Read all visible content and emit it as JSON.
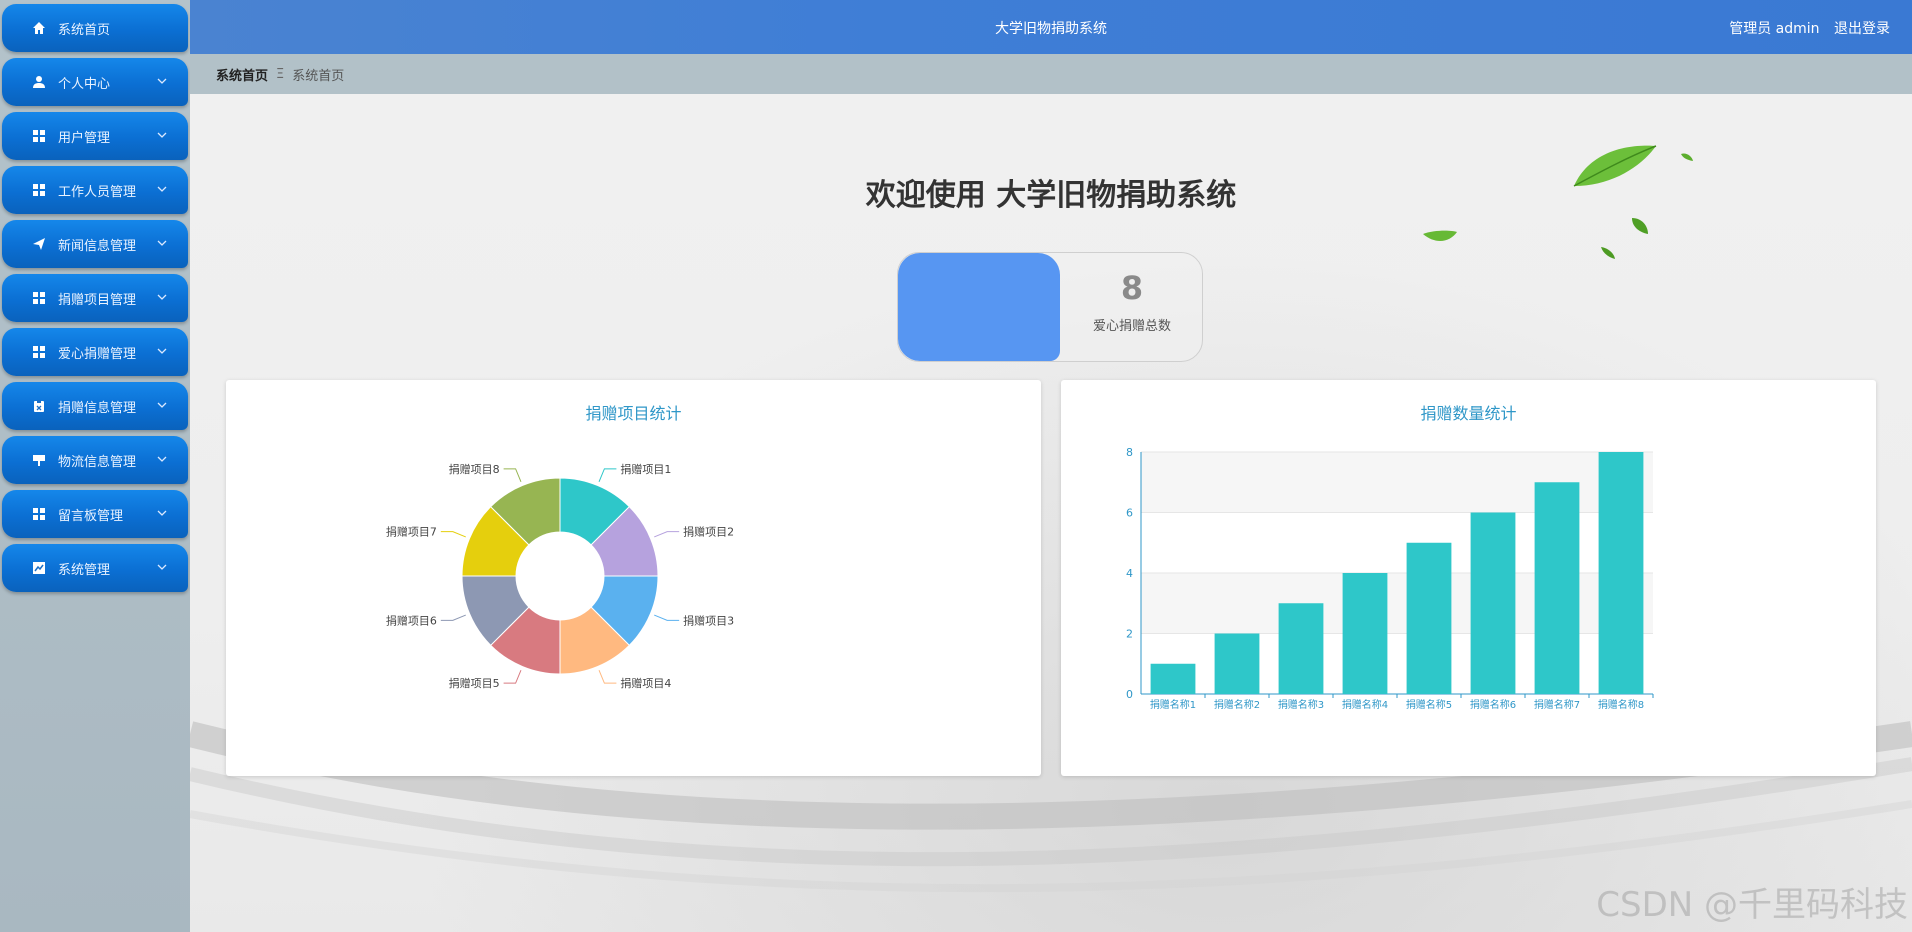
{
  "sidebar": {
    "items": [
      {
        "label": "系统首页",
        "icon": "home-icon",
        "chevron": false
      },
      {
        "label": "个人中心",
        "icon": "user-icon",
        "chevron": true
      },
      {
        "label": "用户管理",
        "icon": "grid-icon",
        "chevron": true
      },
      {
        "label": "工作人员管理",
        "icon": "grid-icon",
        "chevron": true
      },
      {
        "label": "新闻信息管理",
        "icon": "send-icon",
        "chevron": true
      },
      {
        "label": "捐赠项目管理",
        "icon": "grid-icon",
        "chevron": true
      },
      {
        "label": "爱心捐赠管理",
        "icon": "grid-icon",
        "chevron": true
      },
      {
        "label": "捐赠信息管理",
        "icon": "clipboard-icon",
        "chevron": true
      },
      {
        "label": "物流信息管理",
        "icon": "stand-icon",
        "chevron": true
      },
      {
        "label": "留言板管理",
        "icon": "grid-icon",
        "chevron": true
      },
      {
        "label": "系统管理",
        "icon": "chart-icon",
        "chevron": true
      }
    ]
  },
  "header": {
    "title": "大学旧物捐助系统",
    "user_label": "管理员 admin",
    "logout_label": "退出登录"
  },
  "breadcrumb": {
    "home": "系统首页",
    "sep": "Ξ",
    "current": "系统首页"
  },
  "main": {
    "welcome": "欢迎使用 大学旧物捐助系统",
    "stat": {
      "value": "8",
      "label": "爱心捐赠总数"
    }
  },
  "colors": {
    "accent": "#2f97c8",
    "bar": "#2ec7c9",
    "pie": [
      "#2ec7c9",
      "#b6a2de",
      "#5ab1ef",
      "#ffb980",
      "#d87a80",
      "#8d98b3",
      "#e5cf0d",
      "#97b552"
    ]
  },
  "chart_data": [
    {
      "type": "pie",
      "title": "捐赠项目统计",
      "categories": [
        "捐赠项目1",
        "捐赠项目2",
        "捐赠项目3",
        "捐赠项目4",
        "捐赠项目5",
        "捐赠项目6",
        "捐赠项目7",
        "捐赠项目8"
      ],
      "values": [
        1,
        1,
        1,
        1,
        1,
        1,
        1,
        1
      ],
      "donut": true,
      "legend": "none"
    },
    {
      "type": "bar",
      "title": "捐赠数量统计",
      "categories": [
        "捐赠名称1",
        "捐赠名称2",
        "捐赠名称3",
        "捐赠名称4",
        "捐赠名称5",
        "捐赠名称6",
        "捐赠名称7",
        "捐赠名称8"
      ],
      "values": [
        1,
        2,
        3,
        4,
        5,
        6,
        7,
        8
      ],
      "ylim": [
        0,
        8
      ],
      "yticks": [
        0,
        2,
        4,
        6,
        8
      ],
      "grid": true
    }
  ],
  "watermark": "CSDN @千里码科技"
}
